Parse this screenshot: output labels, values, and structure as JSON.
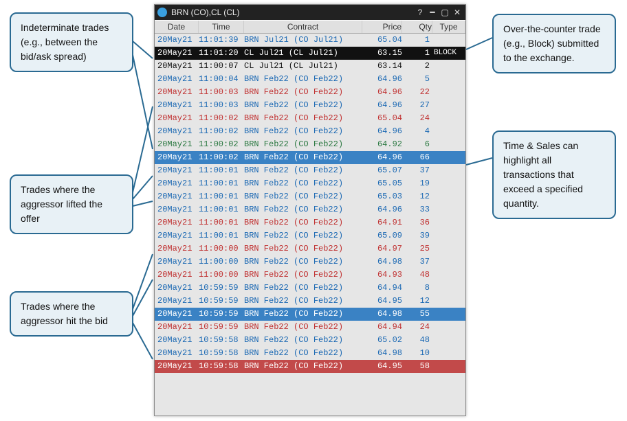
{
  "window": {
    "title": "BRN (CO),CL (CL)"
  },
  "columns": {
    "date": "Date",
    "time": "Time",
    "contract": "Contract",
    "price": "Price",
    "qty": "Qty",
    "type": "Type"
  },
  "callouts": {
    "left1": "Indeterminate trades (e.g., between the bid/ask spread)",
    "left2": "Trades where the aggressor lifted the offer",
    "left3": "Trades where the aggressor hit the bid",
    "right1": "Over-the-counter trade (e.g., Block) submitted to the exchange.",
    "right2": "Time & Sales can highlight all transactions that exceed a specified quantity."
  },
  "rows": [
    {
      "date": "20May21",
      "time": "11:01:39",
      "contract": "BRN Jul21 (CO Jul21)",
      "price": "65.04",
      "qty": "1",
      "type": "",
      "style": "lift",
      "bg": ""
    },
    {
      "date": "20May21",
      "time": "11:01:20",
      "contract": "CL Jul21 (CL Jul21)",
      "price": "63.15",
      "qty": "1",
      "type": "BLOCK",
      "style": "black",
      "bg": "sel"
    },
    {
      "date": "20May21",
      "time": "11:00:07",
      "contract": "CL Jul21 (CL Jul21)",
      "price": "63.14",
      "qty": "2",
      "type": "",
      "style": "black",
      "bg": ""
    },
    {
      "date": "20May21",
      "time": "11:00:04",
      "contract": "BRN Feb22 (CO Feb22)",
      "price": "64.96",
      "qty": "5",
      "type": "",
      "style": "lift",
      "bg": ""
    },
    {
      "date": "20May21",
      "time": "11:00:03",
      "contract": "BRN Feb22 (CO Feb22)",
      "price": "64.96",
      "qty": "22",
      "type": "",
      "style": "hit",
      "bg": ""
    },
    {
      "date": "20May21",
      "time": "11:00:03",
      "contract": "BRN Feb22 (CO Feb22)",
      "price": "64.96",
      "qty": "27",
      "type": "",
      "style": "lift",
      "bg": ""
    },
    {
      "date": "20May21",
      "time": "11:00:02",
      "contract": "BRN Feb22 (CO Feb22)",
      "price": "65.04",
      "qty": "24",
      "type": "",
      "style": "hit",
      "bg": ""
    },
    {
      "date": "20May21",
      "time": "11:00:02",
      "contract": "BRN Feb22 (CO Feb22)",
      "price": "64.96",
      "qty": "4",
      "type": "",
      "style": "lift",
      "bg": ""
    },
    {
      "date": "20May21",
      "time": "11:00:02",
      "contract": "BRN Feb22 (CO Feb22)",
      "price": "64.92",
      "qty": "6",
      "type": "",
      "style": "ind",
      "bg": ""
    },
    {
      "date": "20May21",
      "time": "11:00:02",
      "contract": "BRN Feb22 (CO Feb22)",
      "price": "64.96",
      "qty": "66",
      "type": "",
      "style": "lift",
      "bg": "hl"
    },
    {
      "date": "20May21",
      "time": "11:00:01",
      "contract": "BRN Feb22 (CO Feb22)",
      "price": "65.07",
      "qty": "37",
      "type": "",
      "style": "lift",
      "bg": ""
    },
    {
      "date": "20May21",
      "time": "11:00:01",
      "contract": "BRN Feb22 (CO Feb22)",
      "price": "65.05",
      "qty": "19",
      "type": "",
      "style": "lift",
      "bg": ""
    },
    {
      "date": "20May21",
      "time": "11:00:01",
      "contract": "BRN Feb22 (CO Feb22)",
      "price": "65.03",
      "qty": "12",
      "type": "",
      "style": "lift",
      "bg": ""
    },
    {
      "date": "20May21",
      "time": "11:00:01",
      "contract": "BRN Feb22 (CO Feb22)",
      "price": "64.96",
      "qty": "33",
      "type": "",
      "style": "lift",
      "bg": ""
    },
    {
      "date": "20May21",
      "time": "11:00:01",
      "contract": "BRN Feb22 (CO Feb22)",
      "price": "64.91",
      "qty": "36",
      "type": "",
      "style": "hit",
      "bg": ""
    },
    {
      "date": "20May21",
      "time": "11:00:01",
      "contract": "BRN Feb22 (CO Feb22)",
      "price": "65.09",
      "qty": "39",
      "type": "",
      "style": "lift",
      "bg": ""
    },
    {
      "date": "20May21",
      "time": "11:00:00",
      "contract": "BRN Feb22 (CO Feb22)",
      "price": "64.97",
      "qty": "25",
      "type": "",
      "style": "hit",
      "bg": ""
    },
    {
      "date": "20May21",
      "time": "11:00:00",
      "contract": "BRN Feb22 (CO Feb22)",
      "price": "64.98",
      "qty": "37",
      "type": "",
      "style": "lift",
      "bg": ""
    },
    {
      "date": "20May21",
      "time": "11:00:00",
      "contract": "BRN Feb22 (CO Feb22)",
      "price": "64.93",
      "qty": "48",
      "type": "",
      "style": "hit",
      "bg": ""
    },
    {
      "date": "20May21",
      "time": "10:59:59",
      "contract": "BRN Feb22 (CO Feb22)",
      "price": "64.94",
      "qty": "8",
      "type": "",
      "style": "lift",
      "bg": ""
    },
    {
      "date": "20May21",
      "time": "10:59:59",
      "contract": "BRN Feb22 (CO Feb22)",
      "price": "64.95",
      "qty": "12",
      "type": "",
      "style": "lift",
      "bg": ""
    },
    {
      "date": "20May21",
      "time": "10:59:59",
      "contract": "BRN Feb22 (CO Feb22)",
      "price": "64.98",
      "qty": "55",
      "type": "",
      "style": "lift",
      "bg": "hl"
    },
    {
      "date": "20May21",
      "time": "10:59:59",
      "contract": "BRN Feb22 (CO Feb22)",
      "price": "64.94",
      "qty": "24",
      "type": "",
      "style": "hit",
      "bg": ""
    },
    {
      "date": "20May21",
      "time": "10:59:58",
      "contract": "BRN Feb22 (CO Feb22)",
      "price": "65.02",
      "qty": "48",
      "type": "",
      "style": "lift",
      "bg": ""
    },
    {
      "date": "20May21",
      "time": "10:59:58",
      "contract": "BRN Feb22 (CO Feb22)",
      "price": "64.98",
      "qty": "10",
      "type": "",
      "style": "lift",
      "bg": ""
    },
    {
      "date": "20May21",
      "time": "10:59:58",
      "contract": "BRN Feb22 (CO Feb22)",
      "price": "64.95",
      "qty": "58",
      "type": "",
      "style": "hit",
      "bg": "hl-red"
    }
  ]
}
